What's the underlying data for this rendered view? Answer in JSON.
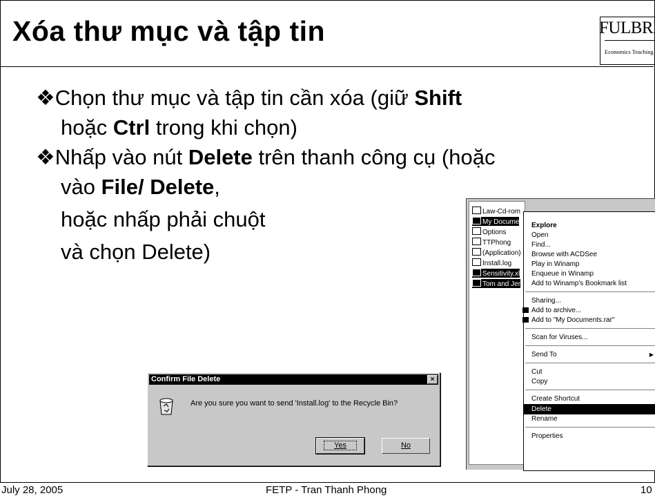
{
  "slide": {
    "title": "Xóa thư mục và tập tin",
    "logo_big": "FULBRIGHT",
    "logo_small": "Economics Teaching Program",
    "bullet_symbol": "❖",
    "b1": {
      "t1": "Chọn thư mục và tập tin cần xóa (giữ ",
      "k1": "Shift",
      "t2": "hoặc ",
      "k2": "Ctrl",
      "t3": " trong khi chọn)"
    },
    "b2": {
      "t1": "Nhấp vào nút ",
      "k1": "Delete",
      "t2": " trên thanh công cụ (hoặc",
      "t3": "vào ",
      "k2": "File/ Delete",
      "t4": ",",
      "l2": "hoặc nhấp phải chuột",
      "l3": "và chọn Delete)"
    }
  },
  "footer": {
    "date": "July 28, 2005",
    "center": "FETP - Tran Thanh Phong",
    "page": "10"
  },
  "dialog": {
    "title": "Confirm File Delete",
    "close": "×",
    "message": "Are you sure you want to send 'Install.log' to the Recycle Bin?",
    "yes": "Yes",
    "no": "No",
    "icon": "recycle-bin-icon"
  },
  "explorer": {
    "tree": [
      {
        "label": "Law-Cd-rom",
        "selected": false
      },
      {
        "label": "My Docume",
        "selected": true
      },
      {
        "label": "Options",
        "selected": false
      },
      {
        "label": "TTPhong",
        "selected": false
      },
      {
        "label": "(Application)",
        "selected": false
      },
      {
        "label": "Install.log",
        "selected": false
      },
      {
        "label": "Sensitivity.xl",
        "selected": true
      },
      {
        "label": "Tom and Jer",
        "selected": true
      }
    ],
    "menu": {
      "explore": "Explore",
      "open": "Open",
      "find": "Find...",
      "browse": "Browse with ACDSee",
      "play": "Play in Winamp",
      "enqueue": "Enqueue in Winamp",
      "bookmark": "Add to Winamp's Bookmark list",
      "sharing": "Sharing...",
      "archive": "Add to archive...",
      "rar": "Add to \"My Documents.rar\"",
      "scan": "Scan for Viruses...",
      "sendto": "Send To",
      "cut": "Cut",
      "copy": "Copy",
      "shortcut": "Create Shortcut",
      "delete": "Delete",
      "rename": "Rename",
      "properties": "Properties"
    }
  }
}
